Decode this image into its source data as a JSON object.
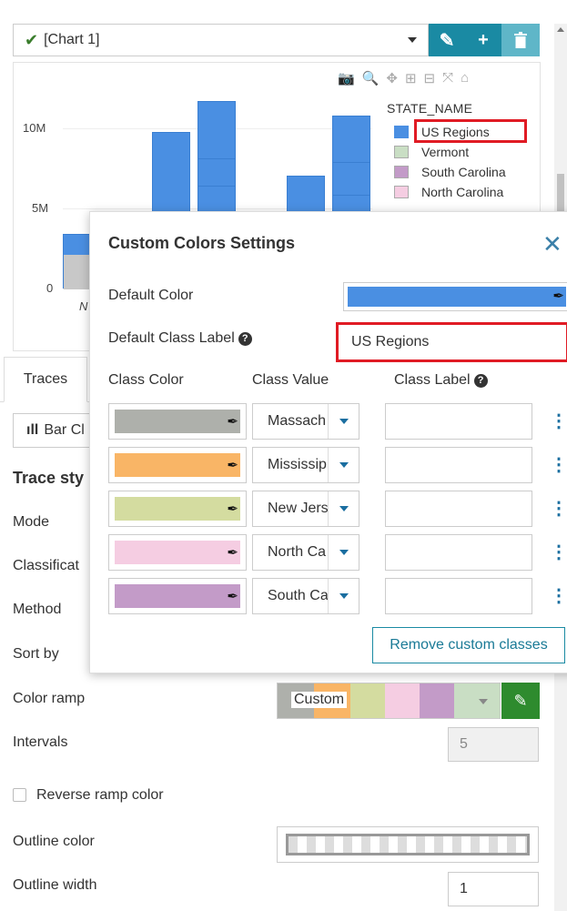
{
  "toolbar": {
    "chart_name": "[Chart 1]",
    "edit_icon": "pencil-icon",
    "add_icon": "plus-icon",
    "delete_icon": "trash-icon"
  },
  "chart_data": {
    "type": "bar",
    "yticks": [
      "10M",
      "5M",
      "0"
    ],
    "ylim": [
      0,
      13000000
    ],
    "bars_visible": [
      {
        "value": 3000000
      },
      {
        "value": 9600000
      },
      {
        "value": 11700000
      },
      {
        "value": 6900000
      },
      {
        "value": 10700000
      }
    ],
    "xtick_partial": "N",
    "legend": {
      "title": "STATE_NAME",
      "entries": [
        {
          "label": "US Regions",
          "color": "#4a8fe2"
        },
        {
          "label": "Vermont",
          "color": "#c9dec4"
        },
        {
          "label": "South Carolina",
          "color": "#c39bc8"
        },
        {
          "label": "North Carolina",
          "color": "#f5cde2"
        }
      ]
    }
  },
  "left_panel": {
    "tab_traces": "Traces",
    "trace_type": "Bar Cl",
    "section_title": "Trace sty",
    "labels": {
      "mode": "Mode",
      "classification": "Classificat",
      "method": "Method",
      "sort_by": "Sort by",
      "color_ramp": "Color ramp",
      "intervals": "Intervals",
      "reverse": "Reverse ramp color",
      "outline_color": "Outline color",
      "outline_width": "Outline width"
    },
    "color_ramp_value": "Custom",
    "ramp_colors": [
      "#aeb0ab",
      "#f9b566",
      "#d4dca0",
      "#f5cde2",
      "#c39bc8",
      "#c9dec4"
    ],
    "intervals_value": "5",
    "outline_width_value": "1"
  },
  "popover": {
    "title": "Custom Colors Settings",
    "default_color_label": "Default Color",
    "default_color": "#4a8fe2",
    "default_class_label_label": "Default Class Label",
    "default_class_label_value": "US Regions",
    "col_class_color": "Class Color",
    "col_class_value": "Class Value",
    "col_class_label": "Class Label",
    "rows": [
      {
        "color": "#aeb0ab",
        "value": "Massach",
        "label": ""
      },
      {
        "color": "#f9b566",
        "value": "Mississip",
        "label": ""
      },
      {
        "color": "#d4dca0",
        "value": "New Jers",
        "label": ""
      },
      {
        "color": "#f5cde2",
        "value": "North Ca",
        "label": ""
      },
      {
        "color": "#c39bc8",
        "value": "South Ca",
        "label": ""
      }
    ],
    "remove_button": "Remove custom classes"
  }
}
